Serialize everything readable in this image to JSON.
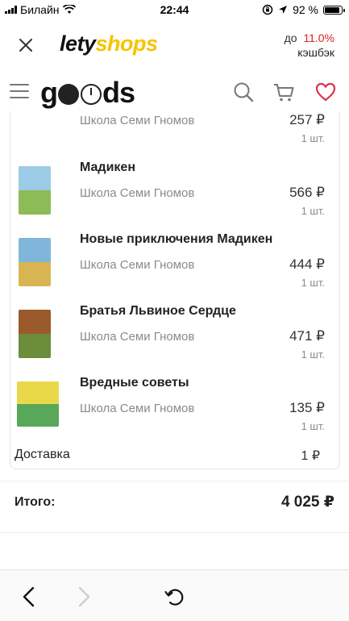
{
  "status_bar": {
    "carrier": "Билайн",
    "time": "22:44",
    "battery": "92 %",
    "battery_level": 0.92
  },
  "letyshops": {
    "logo_part1": "lety",
    "logo_part2": "shops",
    "cashback_prefix": "до",
    "cashback_percent": "11.0%",
    "cashback_label": "кэшбэк"
  },
  "goods_header": {
    "logo": "goods"
  },
  "items": [
    {
      "title": "",
      "seller": "Школа Семи Гномов",
      "price": "257 ₽",
      "qty": "1 шт.",
      "cover_top": "#d9c97e",
      "cover_bottom": "#7fb4d8"
    },
    {
      "title": "Мадикен",
      "seller": "Школа Семи Гномов",
      "price": "566 ₽",
      "qty": "1 шт.",
      "cover_top": "#9ccbe6",
      "cover_bottom": "#8dbb56"
    },
    {
      "title": "Новые приключения Мадикен",
      "seller": "Школа Семи Гномов",
      "price": "444 ₽",
      "qty": "1 шт.",
      "cover_top": "#7fb6d9",
      "cover_bottom": "#d8b552"
    },
    {
      "title": "Братья Львиное Сердце",
      "seller": "Школа Семи Гномов",
      "price": "471 ₽",
      "qty": "1 шт.",
      "cover_top": "#9a5a2c",
      "cover_bottom": "#6b8d3c"
    },
    {
      "title": "Вредные советы",
      "seller": "Школа Семи Гномов",
      "price": "135 ₽",
      "qty": "1 шт.",
      "cover_top": "#e9d84a",
      "cover_bottom": "#58a85a"
    }
  ],
  "delivery": {
    "label": "Доставка",
    "value": "1 ₽"
  },
  "total": {
    "label": "Итого:",
    "value": "4 025 ₽"
  },
  "colors": {
    "accent": "#e02020",
    "lety_yellow": "#f7c300",
    "heart": "#e0304a"
  }
}
